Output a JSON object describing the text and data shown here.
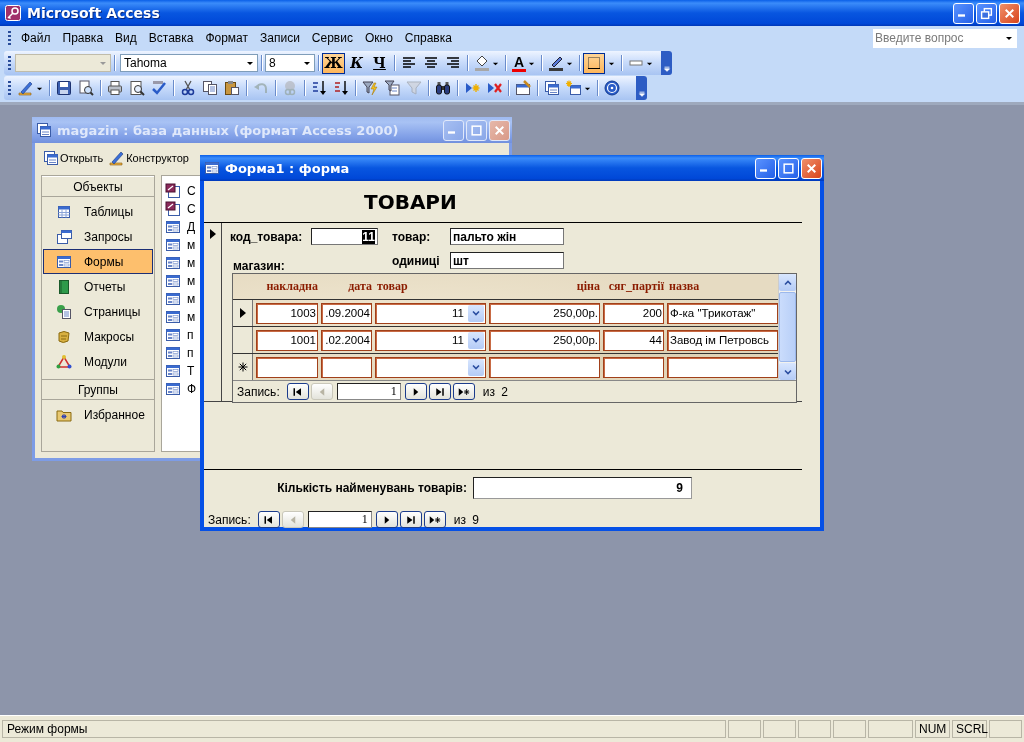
{
  "app": {
    "title": "Microsoft Access"
  },
  "menu": [
    "Файл",
    "Правка",
    "Вид",
    "Вставка",
    "Формат",
    "Записи",
    "Сервис",
    "Окно",
    "Справка"
  ],
  "help_box": {
    "placeholder": "Введите вопрос"
  },
  "format_toolbar": {
    "font": "Tahoma",
    "size": "8",
    "text_buttons": [
      {
        "label": "Ж",
        "selected": true
      },
      {
        "label": "К",
        "selected": false
      },
      {
        "label": "Ч",
        "selected": false
      }
    ],
    "font_color_label": "A",
    "border_button": {
      "selected": true
    }
  },
  "db_window": {
    "title": "magazin : база данных (формат Access 2000)",
    "toolbar": [
      "Открыть",
      "Конструктор"
    ],
    "groups": [
      {
        "heading": "Объекты",
        "items": [
          {
            "kind": "tables",
            "label": "Таблицы",
            "selected": false
          },
          {
            "kind": "queries",
            "label": "Запросы",
            "selected": false
          },
          {
            "kind": "forms",
            "label": "Формы",
            "selected": true
          },
          {
            "kind": "reports",
            "label": "Отчеты",
            "selected": false
          },
          {
            "kind": "pages",
            "label": "Страницы",
            "selected": false
          },
          {
            "kind": "macros",
            "label": "Макросы",
            "selected": false
          },
          {
            "kind": "modules",
            "label": "Модули",
            "selected": false
          }
        ]
      },
      {
        "heading": "Группы",
        "items": [
          {
            "kind": "favorites",
            "label": "Избранное",
            "selected": false
          }
        ]
      }
    ],
    "objects": [
      {
        "kind": "wizard",
        "label": "С"
      },
      {
        "kind": "wizard",
        "label": "С"
      },
      {
        "kind": "form",
        "label": "Д"
      },
      {
        "kind": "form",
        "label": "м"
      },
      {
        "kind": "form",
        "label": "м"
      },
      {
        "kind": "form",
        "label": "м"
      },
      {
        "kind": "form",
        "label": "м"
      },
      {
        "kind": "form",
        "label": "м"
      },
      {
        "kind": "form",
        "label": "п"
      },
      {
        "kind": "form",
        "label": "п"
      },
      {
        "kind": "form",
        "label": "Т"
      },
      {
        "kind": "form",
        "label": "Ф"
      }
    ]
  },
  "form_window": {
    "title": "Форма1 : форма",
    "heading": "ТОВАРИ",
    "current_record": true,
    "fields": [
      {
        "label": "код_товара:",
        "value": "11",
        "text_selected": true
      },
      {
        "label": "товар:",
        "value": "пальто жін",
        "text_selected": false
      },
      {
        "label": "магазин:"
      },
      {
        "label": "одиниці",
        "value": "шт",
        "text_selected": false
      }
    ],
    "subform": {
      "columns": [
        "накладна",
        "дата",
        "товар",
        "ціна",
        "сяг_партії",
        "назва"
      ],
      "rows": [
        {
          "kind": "record",
          "current": true,
          "cells": [
            "1003",
            ".09.2004",
            "11",
            "250,00р.",
            "200",
            "Ф-ка \"Трикотаж\""
          ]
        },
        {
          "kind": "record",
          "current": false,
          "cells": [
            "1001",
            ".02.2004",
            "11",
            "250,00р.",
            "44",
            "Завод ім Петровсь"
          ]
        },
        {
          "kind": "new",
          "current": false
        }
      ],
      "nav": {
        "label": "Запись:",
        "record": "1",
        "total": "из 2"
      }
    },
    "count": {
      "label": "Кількість найменувань товарів:",
      "value": "9"
    },
    "nav": {
      "label": "Запись:",
      "record": "1",
      "total": "из 9"
    }
  },
  "status_bar": {
    "text": "Режим формы",
    "indicators": [
      "NUM",
      "SCRL"
    ]
  }
}
